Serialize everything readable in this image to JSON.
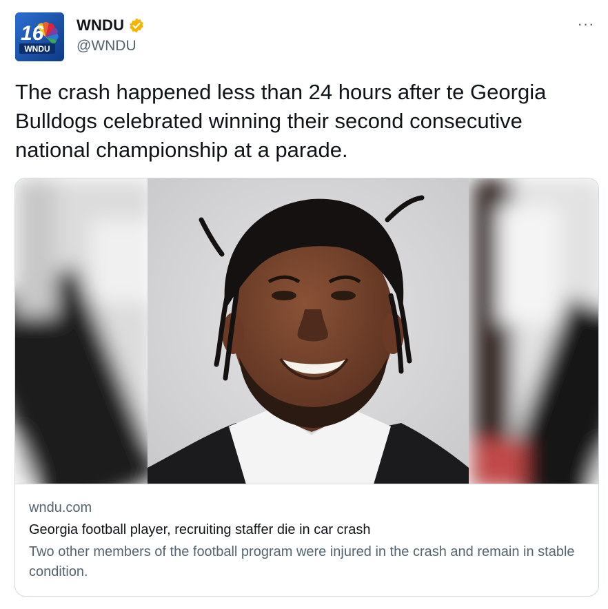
{
  "author": {
    "display_name": "WNDU",
    "handle": "@WNDU",
    "avatar_label": "WNDU",
    "avatar_number": "16",
    "verified": true
  },
  "more_menu_label": "···",
  "tweet": {
    "text": "The crash happened less than 24 hours after te Georgia Bulldogs celebrated winning their second consecutive national championship at a parade."
  },
  "link_card": {
    "domain": "wndu.com",
    "title": "Georgia football player, recruiting staffer die in car crash",
    "description": "Two other members of the football program were injured in the crash and remain in stable condition."
  },
  "colors": {
    "verified_badge": "#f4b400",
    "secondary_text": "#536471",
    "border": "#cfd9de",
    "avatar_bg": "#1d4fa3"
  },
  "icons": [
    "verified-badge-icon",
    "more-options-icon",
    "wndu-logo-icon"
  ]
}
